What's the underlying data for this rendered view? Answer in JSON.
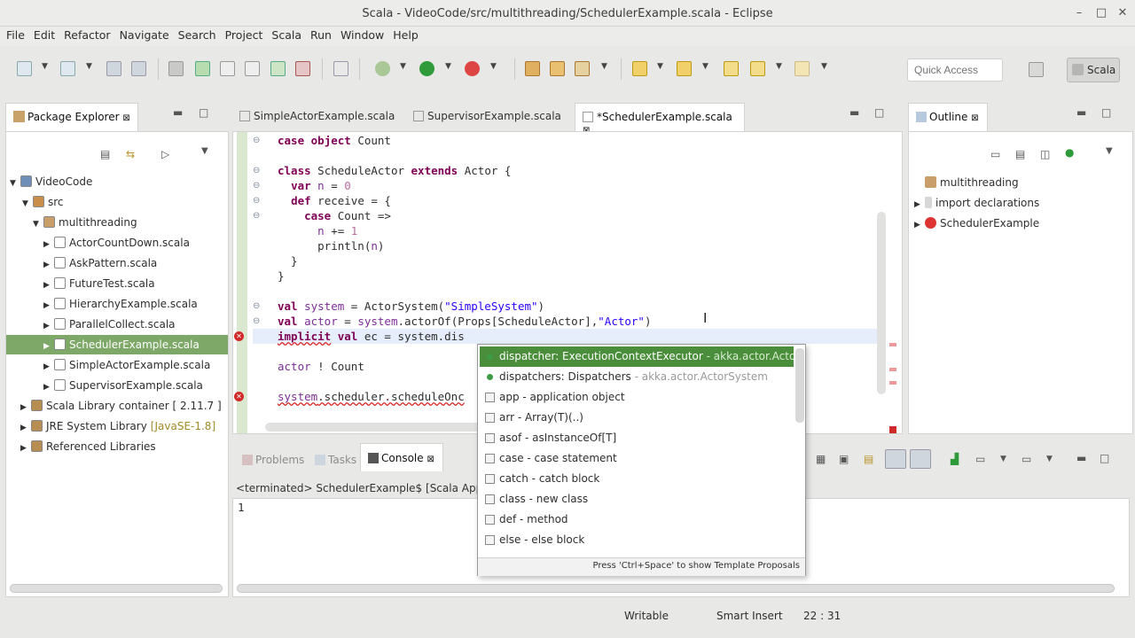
{
  "window": {
    "title": "Scala - VideoCode/src/multithreading/SchedulerExample.scala - Eclipse",
    "minimize": "–",
    "maximize": "□",
    "close": "✕"
  },
  "menu": [
    "File",
    "Edit",
    "Refactor",
    "Navigate",
    "Search",
    "Project",
    "Scala",
    "Run",
    "Window",
    "Help"
  ],
  "toolbar": {
    "quick_access_placeholder": "Quick Access",
    "perspective": "Scala"
  },
  "package_explorer": {
    "tab": "Package Explorer",
    "items": [
      {
        "label": "VideoCode",
        "extra": ""
      },
      {
        "label": "src",
        "extra": ""
      },
      {
        "label": "multithreading",
        "extra": ""
      },
      {
        "label": "ActorCountDown.scala",
        "extra": ""
      },
      {
        "label": "AskPattern.scala",
        "extra": ""
      },
      {
        "label": "FutureTest.scala",
        "extra": ""
      },
      {
        "label": "HierarchyExample.scala",
        "extra": ""
      },
      {
        "label": "ParallelCollect.scala",
        "extra": ""
      },
      {
        "label": "SchedulerExample.scala",
        "extra": ""
      },
      {
        "label": "SimpleActorExample.scala",
        "extra": ""
      },
      {
        "label": "SupervisorExample.scala",
        "extra": ""
      },
      {
        "label": "Scala Library container [ 2.11.7 ]",
        "extra": ""
      },
      {
        "label": "JRE System Library",
        "extra": "[JavaSE-1.8]"
      },
      {
        "label": "Referenced Libraries",
        "extra": ""
      }
    ]
  },
  "editor": {
    "tabs": [
      "SimpleActorExample.scala",
      "SupervisorExample.scala",
      "*SchedulerExample.scala"
    ]
  },
  "outline": {
    "tab": "Outline",
    "items": [
      "multithreading",
      "import declarations",
      "SchedulerExample"
    ]
  },
  "console": {
    "tabs": [
      "Problems",
      "Tasks",
      "Console"
    ],
    "header": "<terminated> SchedulerExample$ [Scala Applica",
    "output": "1"
  },
  "autocomplete": {
    "items": [
      {
        "main": "dispatcher: ExecutionContextExecutor",
        "detail": " - akka.actor.ActorSystem"
      },
      {
        "main": "dispatchers: Dispatchers",
        "detail": " - akka.actor.ActorSystem"
      },
      {
        "main": "app - application object",
        "detail": ""
      },
      {
        "main": "arr - Array(T)(..)",
        "detail": ""
      },
      {
        "main": "asof - asInstanceOf[T]",
        "detail": ""
      },
      {
        "main": "case - case statement",
        "detail": ""
      },
      {
        "main": "catch - catch block",
        "detail": ""
      },
      {
        "main": "class - new class",
        "detail": ""
      },
      {
        "main": "def - method",
        "detail": ""
      },
      {
        "main": "else - else block",
        "detail": ""
      }
    ],
    "footer": "Press 'Ctrl+Space' to show Template Proposals"
  },
  "status": {
    "writable": "Writable",
    "insert_mode": "Smart Insert",
    "position": "22 : 31"
  },
  "colors": {
    "accent_green": "#4a8d3a",
    "keyword": "#7f0055",
    "string": "#2a00ff",
    "error": "#d02a2a"
  }
}
